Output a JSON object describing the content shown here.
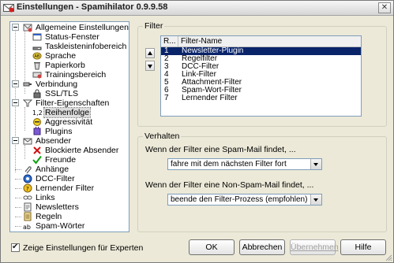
{
  "window": {
    "title": "Einstellungen - Spamihilator 0.9.9.58",
    "close_glyph": "✕"
  },
  "tree": [
    {
      "label": "Allgemeine Einstellungen",
      "icon": "settings-icon"
    },
    {
      "label": "Status-Fenster",
      "icon": "window-icon"
    },
    {
      "label": "Taskleisteninfobereich",
      "icon": "taskbar-icon"
    },
    {
      "label": "Sprache",
      "icon": "language-icon"
    },
    {
      "label": "Papierkorb",
      "icon": "trash-icon"
    },
    {
      "label": "Trainingsbereich",
      "icon": "training-icon"
    },
    {
      "label": "Verbindung",
      "icon": "connection-icon"
    },
    {
      "label": "SSL/TLS",
      "icon": "lock-icon"
    },
    {
      "label": "Filter-Eigenschaften",
      "icon": "filter-icon"
    },
    {
      "label": "Reihenfolge",
      "icon": "order-icon"
    },
    {
      "label": "Aggressivität",
      "icon": "aggressiveness-icon"
    },
    {
      "label": "Plugins",
      "icon": "plugin-icon"
    },
    {
      "label": "Absender",
      "icon": "sender-icon"
    },
    {
      "label": "Blockierte Absender",
      "icon": "blocked-icon"
    },
    {
      "label": "Freunde",
      "icon": "friends-icon"
    },
    {
      "label": "Anhänge",
      "icon": "attachment-icon"
    },
    {
      "label": "DCC-Filter",
      "icon": "dcc-icon"
    },
    {
      "label": "Lernender Filter",
      "icon": "learning-filter-icon"
    },
    {
      "label": "Links",
      "icon": "links-icon"
    },
    {
      "label": "Newsletters",
      "icon": "newsletter-icon"
    },
    {
      "label": "Regeln",
      "icon": "rules-icon"
    },
    {
      "label": "Spam-Wörter",
      "icon": "spam-words-icon"
    }
  ],
  "filter_group": {
    "title": "Filter",
    "columns": [
      "R...",
      "Filter-Name"
    ],
    "rows": [
      {
        "rank": "1",
        "name": "Newsletter-Plugin",
        "selected": true
      },
      {
        "rank": "2",
        "name": "Regelfilter"
      },
      {
        "rank": "3",
        "name": "DCC-Filter"
      },
      {
        "rank": "4",
        "name": "Link-Filter"
      },
      {
        "rank": "5",
        "name": "Attachment-Filter"
      },
      {
        "rank": "6",
        "name": "Spam-Wort-Filter"
      },
      {
        "rank": "7",
        "name": "Lernender Filter"
      }
    ]
  },
  "behavior_group": {
    "title": "Verhalten",
    "spam_label": "Wenn der Filter eine Spam-Mail findet, ...",
    "spam_value": "fahre mit dem nächsten Filter fort",
    "nonspam_label": "Wenn der Filter eine Non-Spam-Mail findet, ...",
    "nonspam_value": "beende den Filter-Prozess (empfohlen)"
  },
  "footer": {
    "expert_checkbox_label": "Zeige Einstellungen für Experten",
    "expert_checked": true,
    "ok": "OK",
    "cancel": "Abbrechen",
    "apply": "Übernehmen",
    "help": "Hilfe"
  },
  "colors": {
    "selection": "#0a246a",
    "tree_border": "#7f9db9"
  }
}
